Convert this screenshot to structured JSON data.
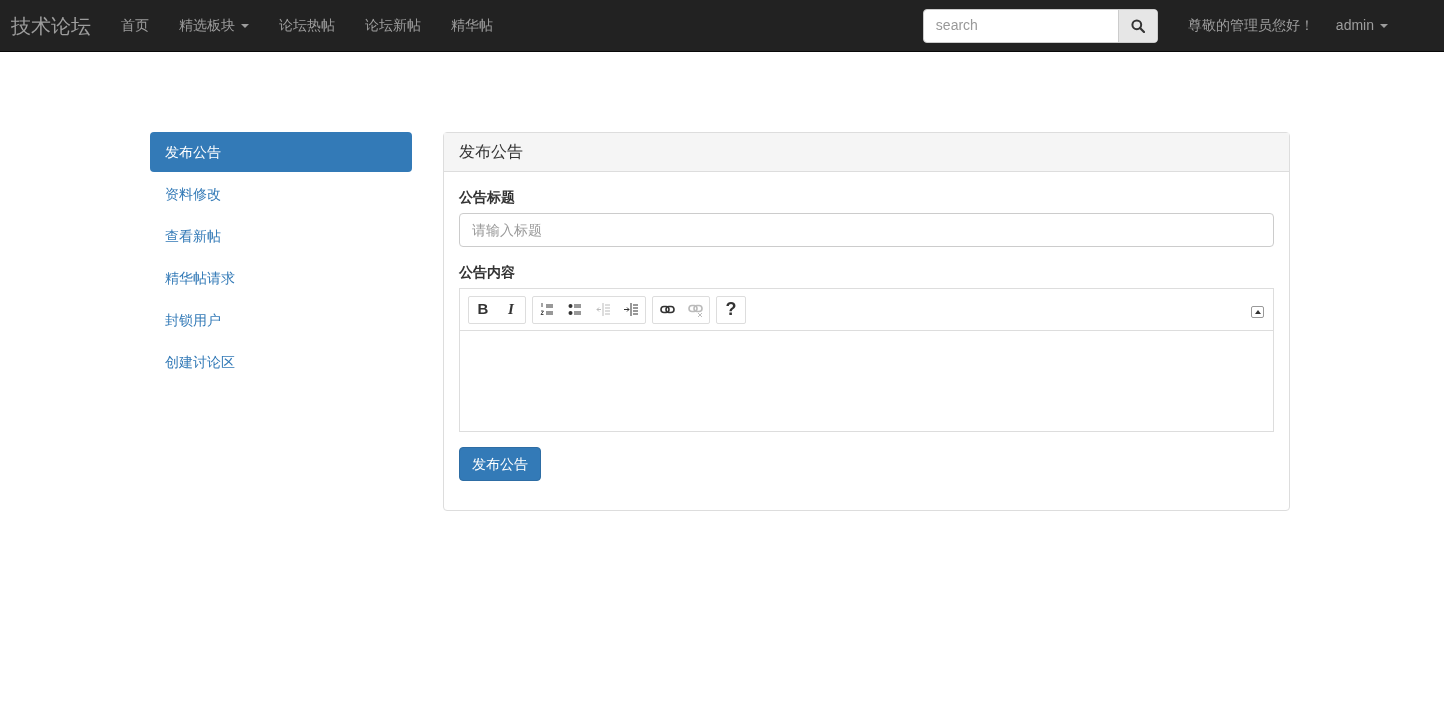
{
  "navbar": {
    "brand": "技术论坛",
    "links": [
      {
        "label": "首页",
        "dropdown": false
      },
      {
        "label": "精选板块",
        "dropdown": true
      },
      {
        "label": "论坛热帖",
        "dropdown": false
      },
      {
        "label": "论坛新帖",
        "dropdown": false
      },
      {
        "label": "精华帖",
        "dropdown": false
      }
    ],
    "search": {
      "placeholder": "search"
    },
    "greeting": "尊敬的管理员您好！",
    "user_menu": {
      "label": "admin",
      "dropdown": true
    }
  },
  "sidebar": {
    "items": [
      {
        "label": "发布公告",
        "selected": true
      },
      {
        "label": "资料修改",
        "selected": false
      },
      {
        "label": "查看新帖",
        "selected": false
      },
      {
        "label": "精华帖请求",
        "selected": false
      },
      {
        "label": "封锁用户",
        "selected": false
      },
      {
        "label": "创建讨论区",
        "selected": false
      }
    ]
  },
  "panel": {
    "title": "发布公告",
    "title_field": {
      "label": "公告标题",
      "placeholder": "请输入标题"
    },
    "content_field": {
      "label": "公告内容"
    },
    "toolbar": [
      [
        {
          "kind": "bold",
          "label": "B",
          "disabled": false
        },
        {
          "kind": "italic",
          "label": "I",
          "disabled": false
        }
      ],
      [
        {
          "kind": "ordered-list",
          "disabled": false
        },
        {
          "kind": "bullet-list",
          "disabled": false
        },
        {
          "kind": "outdent",
          "disabled": true
        },
        {
          "kind": "indent",
          "disabled": false
        }
      ],
      [
        {
          "kind": "link",
          "disabled": false
        },
        {
          "kind": "unlink",
          "disabled": true
        }
      ],
      [
        {
          "kind": "help",
          "label": "?",
          "disabled": false
        }
      ]
    ],
    "submit": "发布公告"
  }
}
